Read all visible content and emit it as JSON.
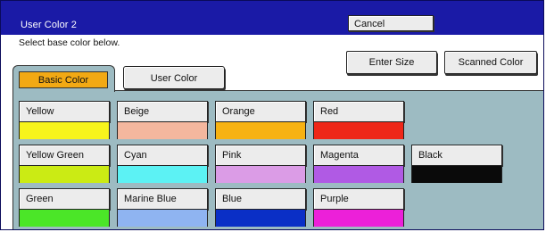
{
  "window": {
    "title": "User Color 2"
  },
  "toolbar": {
    "cancel_label": "Cancel"
  },
  "instruction": "Select base color below.",
  "actions": {
    "enter_size_label": "Enter Size",
    "scanned_color_label": "Scanned Color"
  },
  "tabs": [
    {
      "label": "Basic Color",
      "active": true,
      "accent": "#f2a914"
    },
    {
      "label": "User Color",
      "active": false
    }
  ],
  "panel_bg": "#9dbbc2",
  "colors": [
    {
      "label": "Yellow",
      "swatch": "#f7f41c"
    },
    {
      "label": "Beige",
      "swatch": "#f4b79e"
    },
    {
      "label": "Orange",
      "swatch": "#f7b212"
    },
    {
      "label": "Red",
      "swatch": "#ee2718"
    },
    {
      "label": "Yellow Green",
      "swatch": "#cbeb14"
    },
    {
      "label": "Cyan",
      "swatch": "#5cf2f4"
    },
    {
      "label": "Pink",
      "swatch": "#db9ce6"
    },
    {
      "label": "Magenta",
      "swatch": "#b05ae4"
    },
    {
      "label": "Black",
      "swatch": "#0a0a0a"
    },
    {
      "label": "Green",
      "swatch": "#4be628"
    },
    {
      "label": "Marine Blue",
      "swatch": "#8fb4f1"
    },
    {
      "label": "Blue",
      "swatch": "#0a2fc6"
    },
    {
      "label": "Purple",
      "swatch": "#ec20d9"
    }
  ]
}
